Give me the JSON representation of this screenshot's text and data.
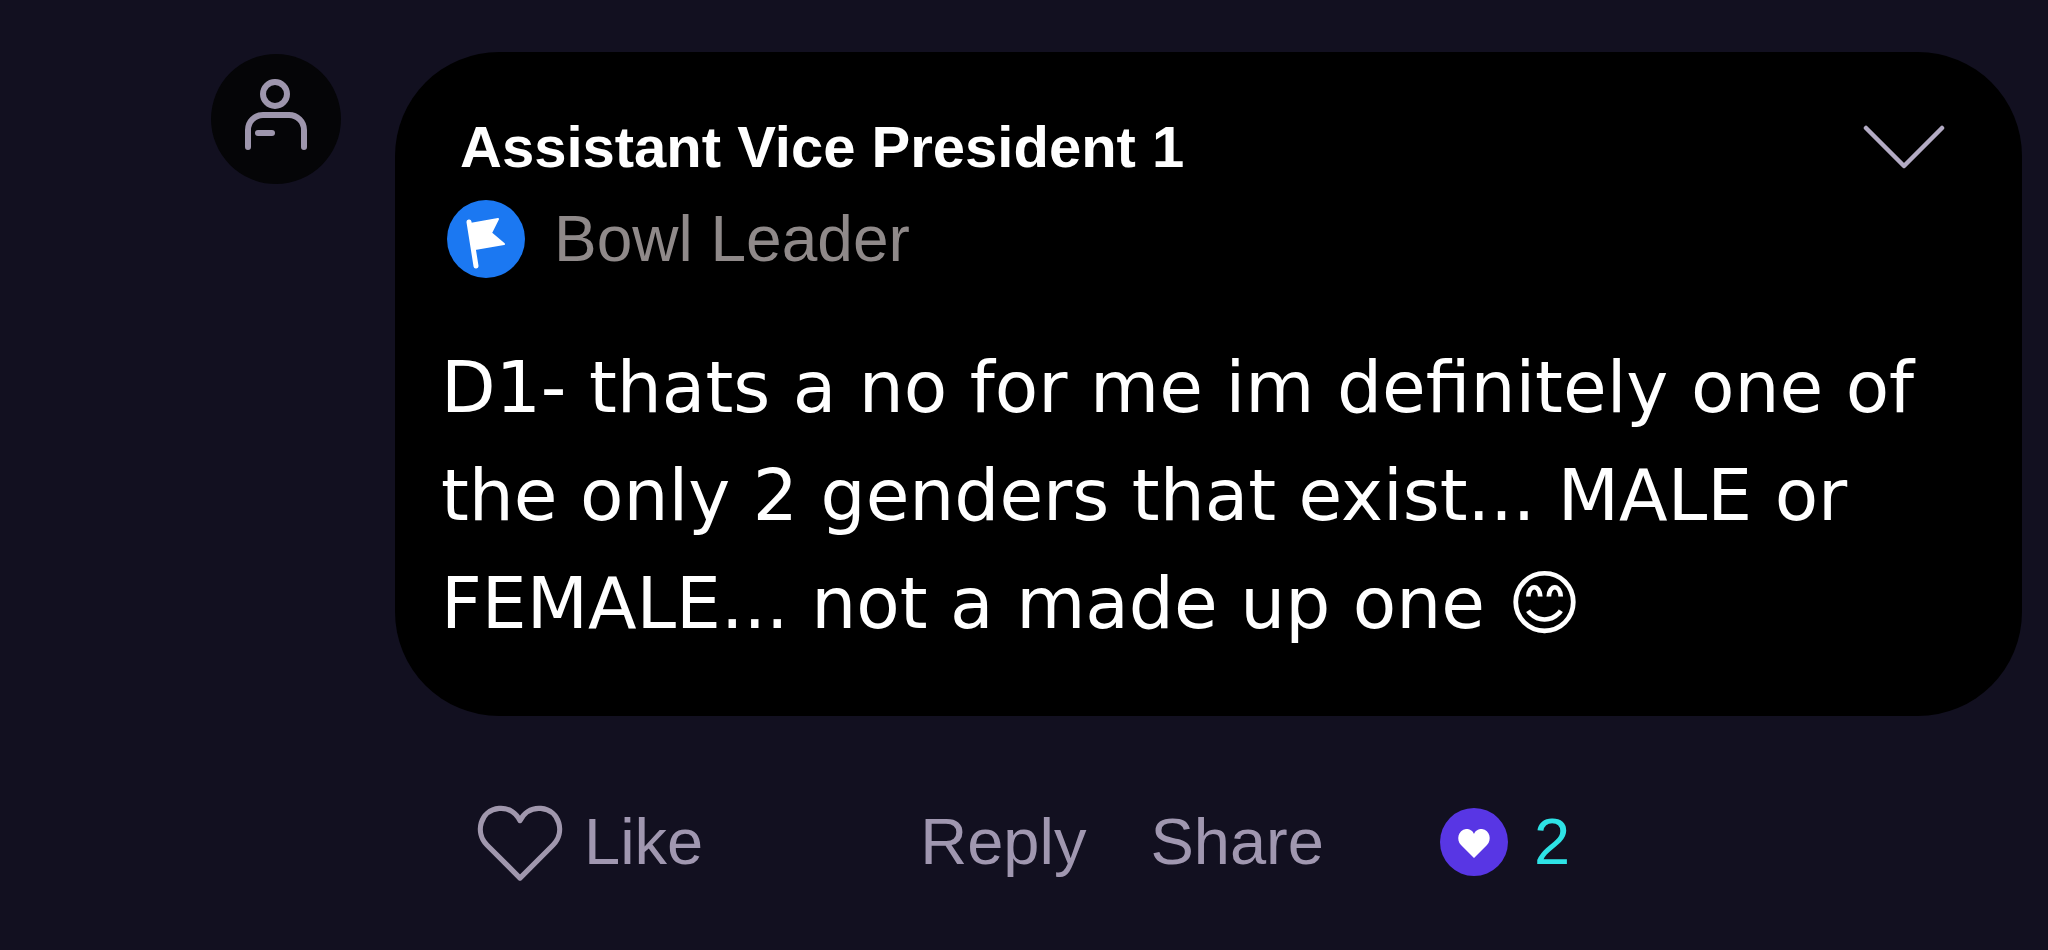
{
  "author": {
    "name": "Assistant Vice President 1",
    "badge": {
      "label": "Bowl Leader"
    }
  },
  "comment": {
    "text": "D1- thats a no for me im definitely one of the only 2 genders that exist... MALE or FEMALE... not a made up one 😊"
  },
  "actions": [
    {
      "kind": "like",
      "label": "Like",
      "liked": false
    },
    {
      "kind": "reply",
      "label": "Reply"
    },
    {
      "kind": "share",
      "label": "Share"
    }
  ],
  "reactions": {
    "count": "2"
  }
}
